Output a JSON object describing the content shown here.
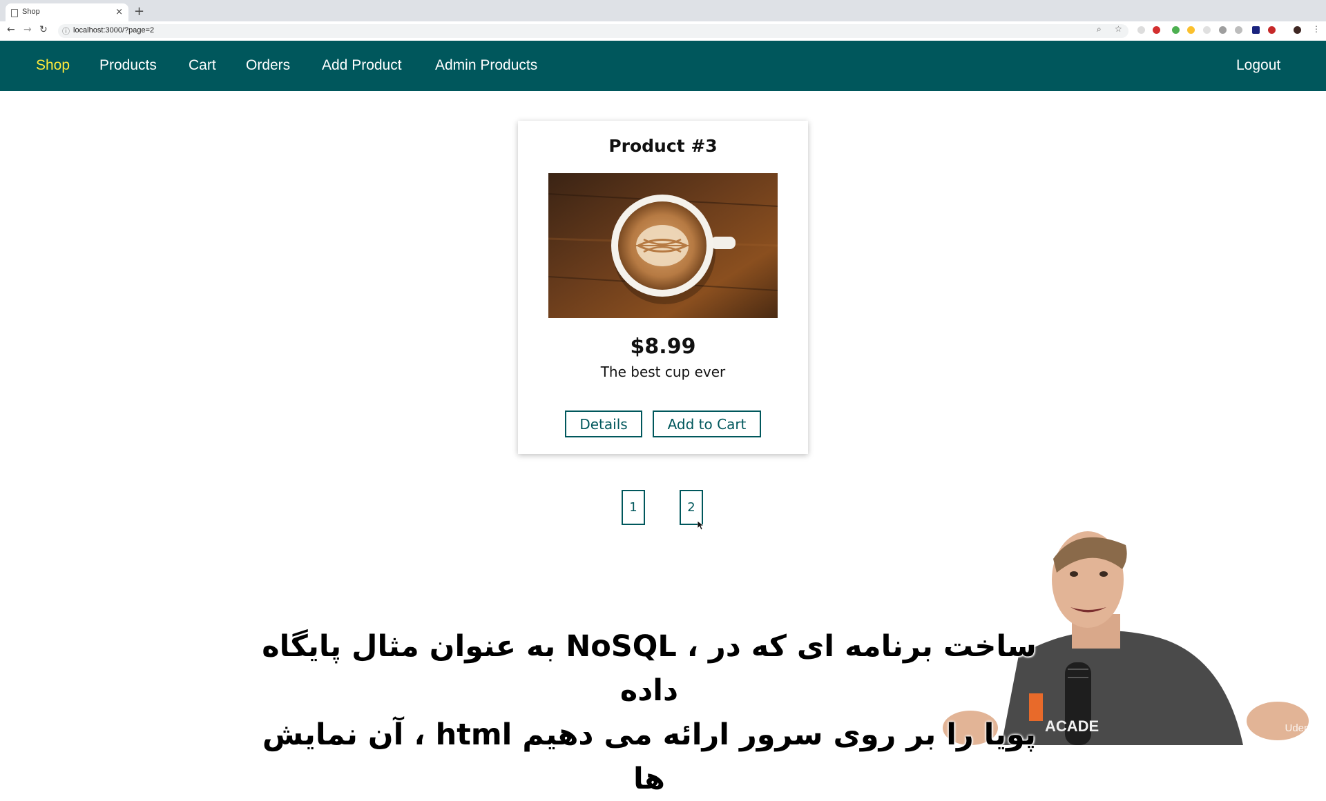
{
  "browser": {
    "tab_title": "Shop",
    "tab_close": "×",
    "new_tab": "+",
    "url": "localhost:3000/?page=2"
  },
  "nav": {
    "items": [
      {
        "label": "Shop",
        "active": true
      },
      {
        "label": "Products"
      },
      {
        "label": "Cart"
      },
      {
        "label": "Orders"
      },
      {
        "label": "Add Product"
      },
      {
        "label": "Admin Products"
      }
    ],
    "logout": "Logout",
    "active_color": "#ffeb3b",
    "bg_color": "#00575c"
  },
  "product": {
    "title": "Product #3",
    "price": "$8.99",
    "description": "The best cup ever",
    "details_label": "Details",
    "add_to_cart_label": "Add to Cart"
  },
  "pagination": {
    "pages": [
      "1",
      "2"
    ]
  },
  "subtitles": {
    "line1": "ساخت برنامه ای که در ، NoSQL به عنوان مثال پایگاه داده",
    "line2": "پویا را بر روی سرور ارائه می دهیم html ، آن نمایش ها"
  },
  "watermark": "Udemy",
  "shirt_text": "ACADE"
}
